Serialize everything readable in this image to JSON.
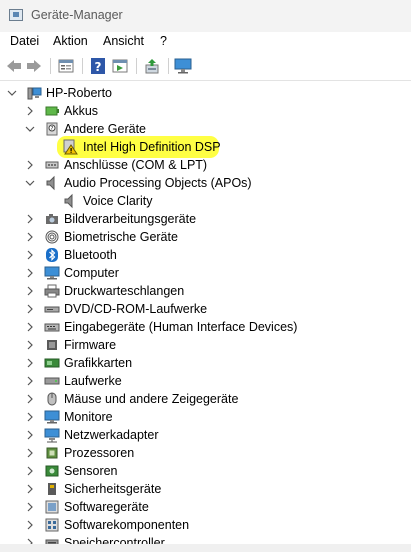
{
  "window": {
    "title": "Geräte-Manager"
  },
  "menu": [
    "Datei",
    "Aktion",
    "Ansicht",
    "?"
  ],
  "toolbar": {
    "icons": [
      "back-arrow-icon",
      "forward-arrow-icon",
      "properties-icon",
      "help-icon",
      "update-driver-icon",
      "scan-hardware-icon",
      "monitor-icon"
    ]
  },
  "tree": {
    "root": "HP-Roberto",
    "items": [
      {
        "label": "Akkus",
        "level": 1,
        "expanded": false,
        "icon": "battery-icon"
      },
      {
        "label": "Andere Geräte",
        "level": 1,
        "expanded": true,
        "icon": "unknown-device-icon"
      },
      {
        "label": "Intel High Definition DSP",
        "level": 2,
        "icon": "warning-device-icon",
        "highlighted": true
      },
      {
        "label": "Anschlüsse (COM & LPT)",
        "level": 1,
        "expanded": false,
        "icon": "port-icon"
      },
      {
        "label": "Audio Processing Objects (APOs)",
        "level": 1,
        "expanded": true,
        "icon": "speaker-icon"
      },
      {
        "label": "Voice Clarity",
        "level": 2,
        "icon": "speaker-icon"
      },
      {
        "label": "Bildverarbeitungsgeräte",
        "level": 1,
        "expanded": false,
        "icon": "camera-icon"
      },
      {
        "label": "Biometrische Geräte",
        "level": 1,
        "expanded": false,
        "icon": "fingerprint-icon"
      },
      {
        "label": "Bluetooth",
        "level": 1,
        "expanded": false,
        "icon": "bluetooth-icon"
      },
      {
        "label": "Computer",
        "level": 1,
        "expanded": false,
        "icon": "computer-icon"
      },
      {
        "label": "Druckwarteschlangen",
        "level": 1,
        "expanded": false,
        "icon": "printer-icon"
      },
      {
        "label": "DVD/CD-ROM-Laufwerke",
        "level": 1,
        "expanded": false,
        "icon": "dvd-drive-icon"
      },
      {
        "label": "Eingabegeräte (Human Interface Devices)",
        "level": 1,
        "expanded": false,
        "icon": "hid-icon"
      },
      {
        "label": "Firmware",
        "level": 1,
        "expanded": false,
        "icon": "firmware-icon"
      },
      {
        "label": "Grafikkarten",
        "level": 1,
        "expanded": false,
        "icon": "display-adapter-icon"
      },
      {
        "label": "Laufwerke",
        "level": 1,
        "expanded": false,
        "icon": "disk-drive-icon"
      },
      {
        "label": "Mäuse und andere Zeigegeräte",
        "level": 1,
        "expanded": false,
        "icon": "mouse-icon"
      },
      {
        "label": "Monitore",
        "level": 1,
        "expanded": false,
        "icon": "monitor-icon"
      },
      {
        "label": "Netzwerkadapter",
        "level": 1,
        "expanded": false,
        "icon": "network-adapter-icon"
      },
      {
        "label": "Prozessoren",
        "level": 1,
        "expanded": false,
        "icon": "processor-icon"
      },
      {
        "label": "Sensoren",
        "level": 1,
        "expanded": false,
        "icon": "sensor-icon"
      },
      {
        "label": "Sicherheitsgeräte",
        "level": 1,
        "expanded": false,
        "icon": "security-device-icon"
      },
      {
        "label": "Softwaregeräte",
        "level": 1,
        "expanded": false,
        "icon": "software-device-icon"
      },
      {
        "label": "Softwarekomponenten",
        "level": 1,
        "expanded": false,
        "icon": "software-component-icon"
      },
      {
        "label": "Speichercontroller",
        "level": 1,
        "expanded": false,
        "icon": "storage-controller-icon"
      }
    ]
  },
  "colors": {
    "highlight": "#ffff3a",
    "accent": "#1a6fc9",
    "warning": "#f2c200"
  }
}
